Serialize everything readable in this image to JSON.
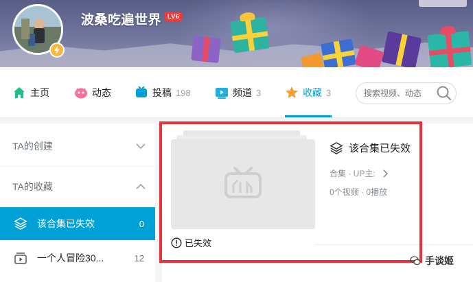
{
  "profile": {
    "username": "波桑吃遍世界",
    "level": "LV6"
  },
  "nav": {
    "items": [
      {
        "label": "主页",
        "count": "",
        "icon": "home-icon"
      },
      {
        "label": "动态",
        "count": "",
        "icon": "activity-icon"
      },
      {
        "label": "投稿",
        "count": "198",
        "icon": "tv-icon"
      },
      {
        "label": "频道",
        "count": "3",
        "icon": "channel-icon"
      },
      {
        "label": "收藏",
        "count": "3",
        "icon": "star-icon"
      }
    ],
    "active": "收藏",
    "search_placeholder": "搜索视频、动态",
    "accent_color": "#00a1d6"
  },
  "sidebar": {
    "sections": [
      {
        "label": "TA的创建",
        "state": "collapsed"
      },
      {
        "label": "TA的收藏",
        "state": "expanded"
      }
    ],
    "items": [
      {
        "label": "该合集已失效",
        "count": "0",
        "active": true,
        "icon": "layers-icon"
      },
      {
        "label": "一个人冒险30...",
        "count": "12",
        "active": false,
        "icon": "video-list-icon"
      }
    ]
  },
  "card": {
    "status": "已失效",
    "title": "该合集已失效",
    "meta": "合集 · UP主:",
    "stats": "0个视频 · 0播放"
  },
  "watermark": {
    "label": "手谈姬"
  },
  "highlight_color": "#e8333a"
}
